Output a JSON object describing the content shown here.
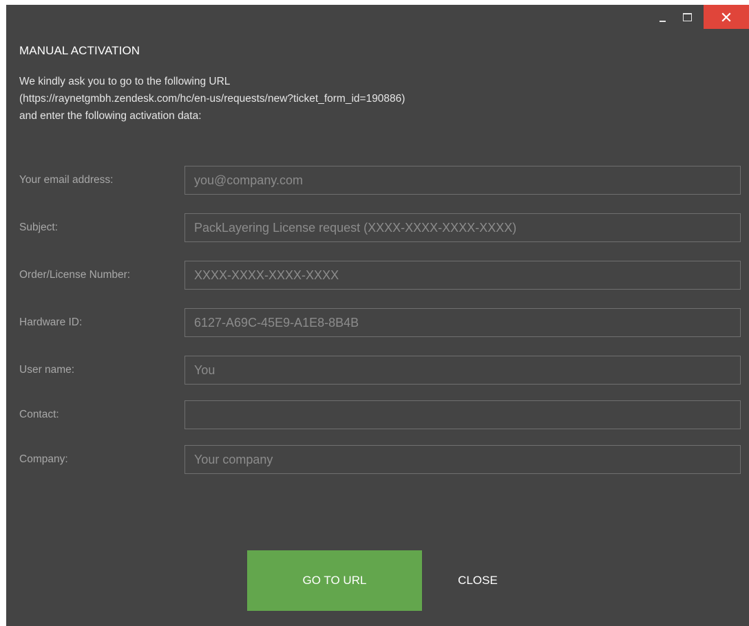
{
  "window": {
    "controls": {
      "minimize_icon": "minimize-icon",
      "maximize_icon": "maximize-icon",
      "close_icon": "close-icon",
      "close_color": "#e0453a"
    }
  },
  "dialog": {
    "title": "MANUAL ACTIVATION",
    "intro_lines": [
      "We kindly ask you to go to the following URL",
      "(https://raynetgmbh.zendesk.com/hc/en-us/requests/new?ticket_form_id=190886)",
      "and enter the following activation data:"
    ]
  },
  "form": {
    "fields": [
      {
        "label": "Your email address:",
        "value": "",
        "placeholder": "you@company.com"
      },
      {
        "label": "Subject:",
        "value": "",
        "placeholder": "PackLayering License request (XXXX-XXXX-XXXX-XXXX)"
      },
      {
        "label": "Order/License Number:",
        "value": "",
        "placeholder": "XXXX-XXXX-XXXX-XXXX"
      },
      {
        "label": "Hardware ID:",
        "value": "6127-A69C-45E9-A1E8-8B4B",
        "placeholder": ""
      },
      {
        "label": "User name:",
        "value": "You",
        "placeholder": ""
      },
      {
        "label": "Contact:",
        "value": "",
        "placeholder": ""
      },
      {
        "label": "Company:",
        "value": "",
        "placeholder": "Your company"
      }
    ]
  },
  "buttons": {
    "go_to_url": "GO TO URL",
    "close": "CLOSE",
    "accent_color": "#63a64d"
  }
}
